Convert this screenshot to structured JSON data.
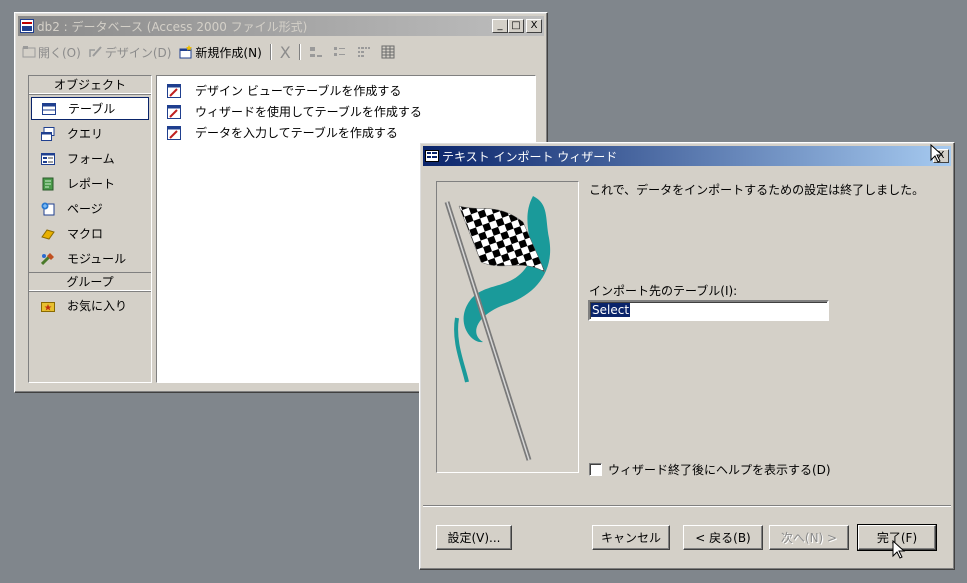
{
  "db_window": {
    "title": "db2 : データベース (Access 2000 ファイル形式)",
    "controls": {
      "minimize": "_",
      "maximize": "□",
      "close": "X"
    },
    "toolbar": {
      "open": "開く(O)",
      "design": "デザイン(D)",
      "new": "新規作成(N)",
      "delete_glyph": "X"
    },
    "objects_header": "オブジェクト",
    "objects": [
      {
        "label": "テーブル",
        "icon": "table-icon",
        "selected": true
      },
      {
        "label": "クエリ",
        "icon": "query-icon"
      },
      {
        "label": "フォーム",
        "icon": "form-icon"
      },
      {
        "label": "レポート",
        "icon": "report-icon"
      },
      {
        "label": "ページ",
        "icon": "page-icon"
      },
      {
        "label": "マクロ",
        "icon": "macro-icon"
      },
      {
        "label": "モジュール",
        "icon": "module-icon"
      }
    ],
    "groups_header": "グループ",
    "groups": [
      {
        "label": "お気に入り",
        "icon": "favorites-icon"
      }
    ],
    "list_items": [
      "デザイン ビューでテーブルを作成する",
      "ウィザードを使用してテーブルを作成する",
      "データを入力してテーブルを作成する"
    ]
  },
  "wizard": {
    "title": "テキスト インポート ウィザード",
    "message": "これで、データをインポートするための設定は終了しました。",
    "import_label": "インポート先のテーブル(I):",
    "table_value": "Select",
    "help_checkbox": "ウィザード終了後にヘルプを表示する(D)",
    "help_checked": false,
    "buttons": {
      "settings": "設定(V)...",
      "cancel": "キャンセル",
      "back": "< 戻る(B)",
      "next": "次へ(N) >",
      "finish": "完了(F)"
    },
    "colors": {
      "title_active": "#0a246a",
      "title_gradient_end": "#a6caf0",
      "face": "#d4d0c8",
      "desktop": "#80868c"
    }
  }
}
